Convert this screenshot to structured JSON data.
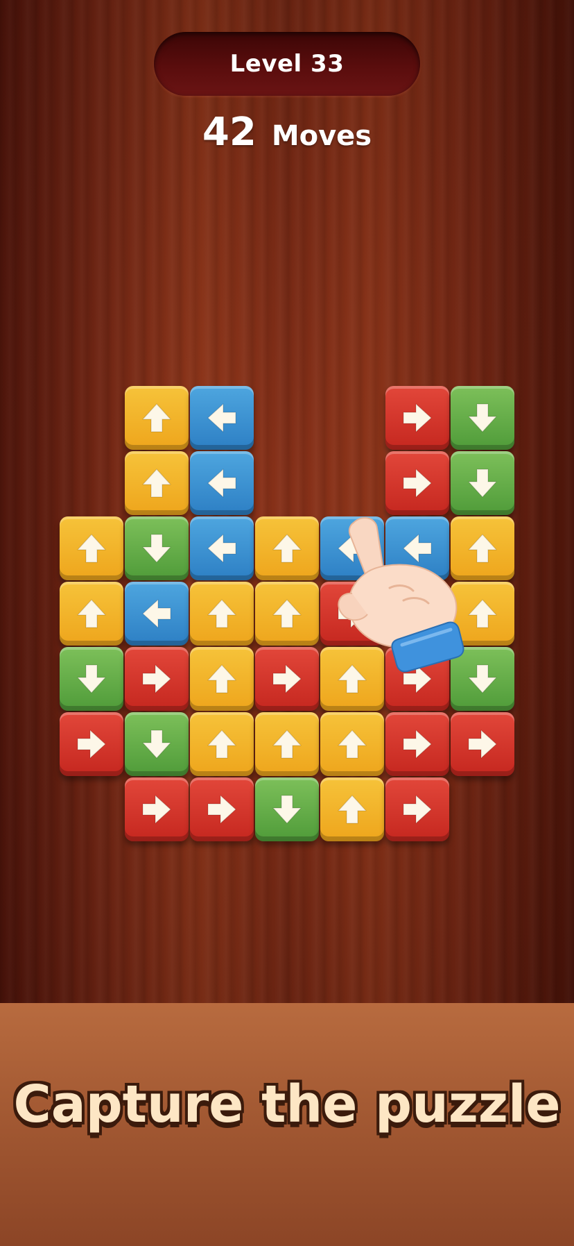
{
  "header": {
    "level_label": "Level 33",
    "moves_count": "42",
    "moves_label": "Moves"
  },
  "board": {
    "tiles": [
      {
        "row": 0,
        "col": 1,
        "color": "yellow",
        "dir": "up"
      },
      {
        "row": 0,
        "col": 2,
        "color": "blue",
        "dir": "left"
      },
      {
        "row": 0,
        "col": 5,
        "color": "red",
        "dir": "right"
      },
      {
        "row": 0,
        "col": 6,
        "color": "green",
        "dir": "down"
      },
      {
        "row": 1,
        "col": 1,
        "color": "yellow",
        "dir": "up"
      },
      {
        "row": 1,
        "col": 2,
        "color": "blue",
        "dir": "left"
      },
      {
        "row": 1,
        "col": 5,
        "color": "red",
        "dir": "right"
      },
      {
        "row": 1,
        "col": 6,
        "color": "green",
        "dir": "down"
      },
      {
        "row": 2,
        "col": 0,
        "color": "yellow",
        "dir": "up"
      },
      {
        "row": 2,
        "col": 1,
        "color": "green",
        "dir": "down"
      },
      {
        "row": 2,
        "col": 2,
        "color": "blue",
        "dir": "left"
      },
      {
        "row": 2,
        "col": 3,
        "color": "yellow",
        "dir": "up"
      },
      {
        "row": 2,
        "col": 4,
        "color": "blue",
        "dir": "left"
      },
      {
        "row": 2,
        "col": 5,
        "color": "blue",
        "dir": "left"
      },
      {
        "row": 2,
        "col": 6,
        "color": "yellow",
        "dir": "up"
      },
      {
        "row": 3,
        "col": 0,
        "color": "yellow",
        "dir": "up"
      },
      {
        "row": 3,
        "col": 1,
        "color": "blue",
        "dir": "left"
      },
      {
        "row": 3,
        "col": 2,
        "color": "yellow",
        "dir": "up"
      },
      {
        "row": 3,
        "col": 3,
        "color": "yellow",
        "dir": "up"
      },
      {
        "row": 3,
        "col": 4,
        "color": "red",
        "dir": "right"
      },
      {
        "row": 3,
        "col": 6,
        "color": "yellow",
        "dir": "up"
      },
      {
        "row": 4,
        "col": 0,
        "color": "green",
        "dir": "down"
      },
      {
        "row": 4,
        "col": 1,
        "color": "red",
        "dir": "right"
      },
      {
        "row": 4,
        "col": 2,
        "color": "yellow",
        "dir": "up"
      },
      {
        "row": 4,
        "col": 3,
        "color": "red",
        "dir": "right"
      },
      {
        "row": 4,
        "col": 4,
        "color": "yellow",
        "dir": "up"
      },
      {
        "row": 4,
        "col": 5,
        "color": "red",
        "dir": "right"
      },
      {
        "row": 4,
        "col": 6,
        "color": "green",
        "dir": "down"
      },
      {
        "row": 5,
        "col": 0,
        "color": "red",
        "dir": "right"
      },
      {
        "row": 5,
        "col": 1,
        "color": "green",
        "dir": "down"
      },
      {
        "row": 5,
        "col": 2,
        "color": "yellow",
        "dir": "up"
      },
      {
        "row": 5,
        "col": 3,
        "color": "yellow",
        "dir": "up"
      },
      {
        "row": 5,
        "col": 4,
        "color": "yellow",
        "dir": "up"
      },
      {
        "row": 5,
        "col": 5,
        "color": "red",
        "dir": "right"
      },
      {
        "row": 5,
        "col": 6,
        "color": "red",
        "dir": "right"
      },
      {
        "row": 6,
        "col": 1,
        "color": "red",
        "dir": "right"
      },
      {
        "row": 6,
        "col": 2,
        "color": "red",
        "dir": "right"
      },
      {
        "row": 6,
        "col": 3,
        "color": "green",
        "dir": "down"
      },
      {
        "row": 6,
        "col": 4,
        "color": "yellow",
        "dir": "up"
      },
      {
        "row": 6,
        "col": 5,
        "color": "red",
        "dir": "right"
      }
    ]
  },
  "footer": {
    "tagline": "Capture the puzzle"
  },
  "colors": {
    "yellow": "#f2b52b",
    "blue": "#3b8fd1",
    "red": "#d3362b",
    "green": "#65ad48",
    "arrow": "#fdf7e8"
  }
}
